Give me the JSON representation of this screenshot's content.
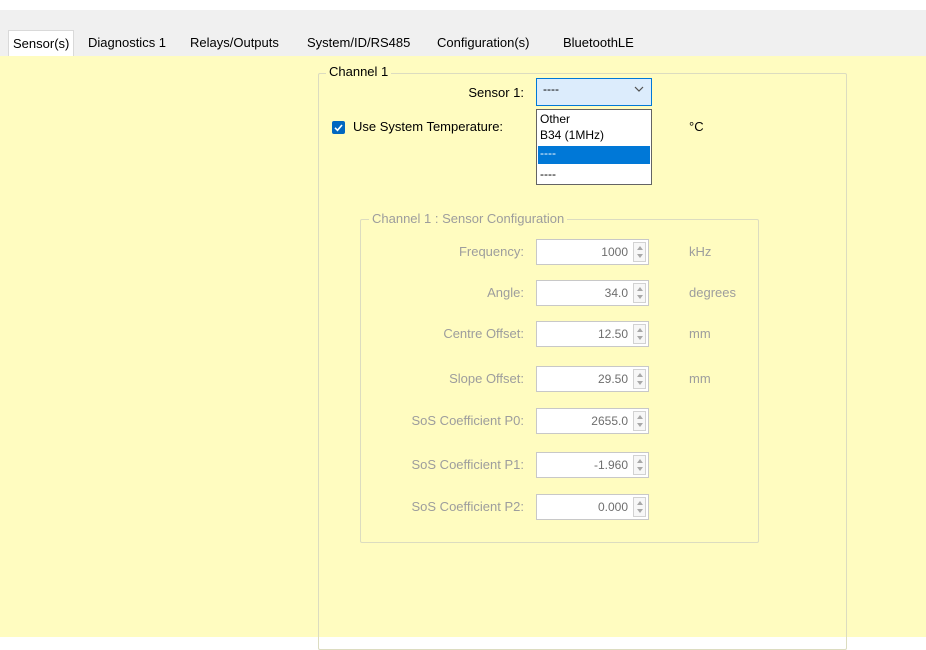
{
  "tabs": [
    {
      "label": "Sensor(s)"
    },
    {
      "label": "Diagnostics 1"
    },
    {
      "label": "Relays/Outputs"
    },
    {
      "label": "System/ID/RS485"
    },
    {
      "label": "Configuration(s)"
    },
    {
      "label": "BluetoothLE"
    }
  ],
  "channel": {
    "legend": "Channel 1",
    "sensor_label": "Sensor 1:",
    "sensor_value": "----",
    "sensor_options": [
      "Other",
      "B34 (1MHz)",
      "----",
      "----"
    ],
    "selected_option_index": 2,
    "use_system_temp_label": "Use System Temperature:",
    "use_system_temp_checked": true,
    "temp_unit": "°C"
  },
  "sensor_config": {
    "legend": "Channel 1 : Sensor Configuration",
    "fields": [
      {
        "label": "Frequency:",
        "value": "1000",
        "unit": "kHz"
      },
      {
        "label": "Angle:",
        "value": "34.0",
        "unit": "degrees"
      },
      {
        "label": "Centre Offset:",
        "value": "12.50",
        "unit": "mm"
      },
      {
        "label": "Slope Offset:",
        "value": "29.50",
        "unit": "mm"
      },
      {
        "label": "SoS Coefficient P0:",
        "value": "2655.0",
        "unit": ""
      },
      {
        "label": "SoS Coefficient P1:",
        "value": "-1.960",
        "unit": ""
      },
      {
        "label": "SoS Coefficient P2:",
        "value": "0.000",
        "unit": ""
      }
    ]
  },
  "colors": {
    "panel_background": "#fffcc0",
    "accent": "#0078d7",
    "disabled_text": "#9d9d9d"
  }
}
